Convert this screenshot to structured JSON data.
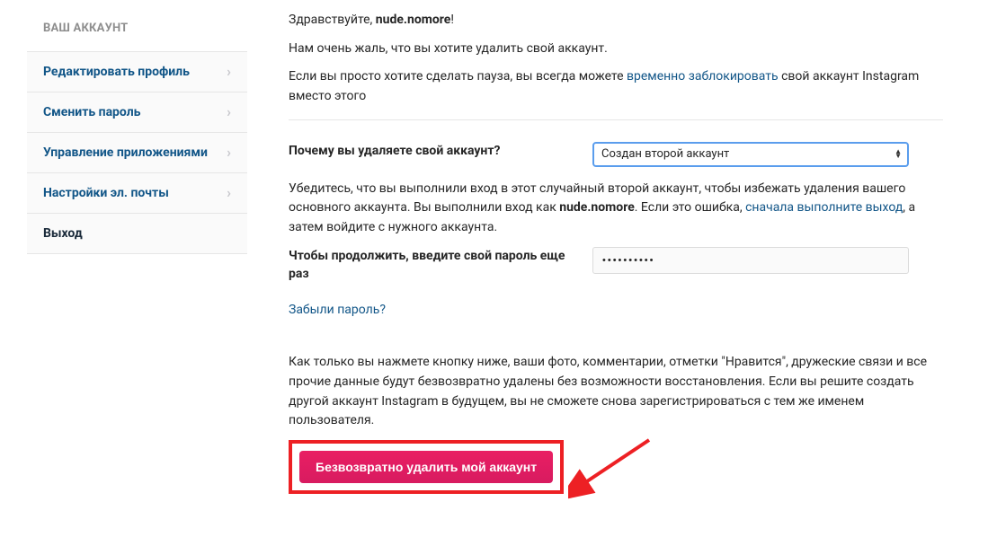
{
  "sidebar": {
    "header": "ВАШ АККАУНТ",
    "items": [
      {
        "label": "Редактировать профиль",
        "link": true,
        "chevron": true
      },
      {
        "label": "Сменить пароль",
        "link": true,
        "chevron": true
      },
      {
        "label": "Управление приложениями",
        "link": true,
        "chevron": true
      },
      {
        "label": "Настройки эл. почты",
        "link": true,
        "chevron": true
      },
      {
        "label": "Выход",
        "link": false,
        "chevron": false
      }
    ]
  },
  "main": {
    "greeting_prefix": "Здравствуйте, ",
    "username": "nude.nomore",
    "greeting_suffix": "!",
    "sorry_text": "Нам очень жаль, что вы хотите удалить свой аккаунт.",
    "pause_prefix": "Если вы просто хотите сделать пауза, вы всегда можете ",
    "pause_link": "временно заблокировать",
    "pause_suffix": " свой аккаунт Instagram вместо этого",
    "reason_label": "Почему вы удаляете свой аккаунт?",
    "reason_selected": "Создан второй аккаунт",
    "verify_prefix": "Убедитесь, что вы выполнили вход в этот случайный второй аккаунт, чтобы избежать удаления вашего основного аккаунта. Вы выполнили вход как ",
    "verify_middle": ". Если это ошибка, ",
    "verify_link": "сначала выполните выход",
    "verify_suffix": ", а затем войдите с нужного аккаунта.",
    "password_label": "Чтобы продолжить, введите свой пароль еще раз",
    "password_value": "••••••••••",
    "forgot_link": "Забыли пароль?",
    "warning_text": "Как только вы нажмете кнопку ниже, ваши фото, комментарии, отметки \"Нравится\", дружеские связи и все прочие данные будут безвозвратно удалены без возможности восстановления. Если вы решите создать другой аккаунт Instagram в будущем, вы не сможете снова зарегистрироваться с тем же именем пользователя.",
    "delete_button": "Безвозвратно удалить мой аккаунт"
  }
}
